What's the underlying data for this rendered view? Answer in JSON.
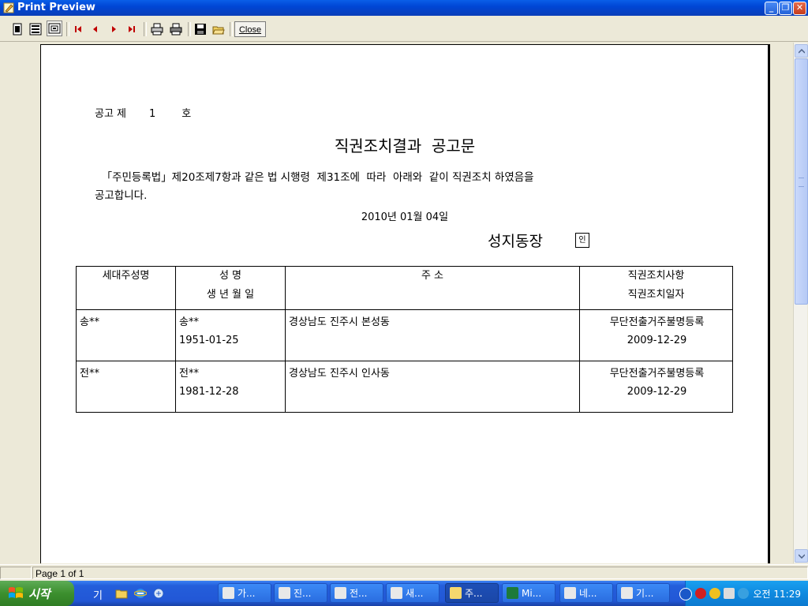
{
  "window": {
    "title": "Print Preview",
    "controls": [
      "minimize",
      "restore",
      "close"
    ]
  },
  "toolbar": {
    "buttons": [
      {
        "name": "one-page-icon"
      },
      {
        "name": "multi-page-icon"
      },
      {
        "name": "zoom-page-icon"
      },
      {
        "name": "first-page-icon"
      },
      {
        "name": "previous-page-icon"
      },
      {
        "name": "next-page-icon"
      },
      {
        "name": "last-page-icon"
      },
      {
        "name": "print-setup-icon"
      },
      {
        "name": "print-icon"
      },
      {
        "name": "save-icon"
      },
      {
        "name": "open-icon"
      }
    ],
    "close_label": "Close"
  },
  "document": {
    "notice_number": "공고 제       1        호",
    "title": "직권조치결과  공고문",
    "body_line1": "  「주민등록법」제20조제7항과 같은 법 시행령  제31조에  따라  아래와  같이 직권조치 하였음을",
    "body_line2": "공고합니다.",
    "date": "2010년 01월 04일",
    "signer": "성지동장",
    "seal": "인",
    "table": {
      "headers": {
        "head": "세대주성명",
        "name_top": "성          명",
        "name_bottom": "생 년 월 일",
        "address": "주                                        소",
        "action_top": "직권조치사항",
        "action_bottom": "직권조치일자"
      },
      "rows": [
        {
          "head": "송**",
          "name": "송**",
          "birth": "1951-01-25",
          "address": "경상남도 진주시 본성동",
          "action": "무단전출거주불명등록",
          "date": "2009-12-29"
        },
        {
          "head": "전**",
          "name": "전**",
          "birth": "1981-12-28",
          "address": "경상남도 진주시 인사동",
          "action": "무단전출거주불명등록",
          "date": "2009-12-29"
        }
      ]
    }
  },
  "statusbar": {
    "page_info": "Page 1 of 1"
  },
  "taskbar": {
    "start_label": "시작",
    "quicklaunch_text": "기",
    "tasks": [
      {
        "label": "가...",
        "color": "#e8e8e8"
      },
      {
        "label": "진...",
        "color": "#e8e8e8"
      },
      {
        "label": "전...",
        "color": "#e8e8e8"
      },
      {
        "label": "새...",
        "color": "#e8e8e8"
      },
      {
        "label": "주...",
        "color": "#f5d76e"
      },
      {
        "label": "Mi...",
        "color": "#1d7a3a"
      },
      {
        "label": "네...",
        "color": "#e8e8e8"
      },
      {
        "label": "기...",
        "color": "#e8e8e8"
      }
    ],
    "clock": "오전 11:29"
  }
}
